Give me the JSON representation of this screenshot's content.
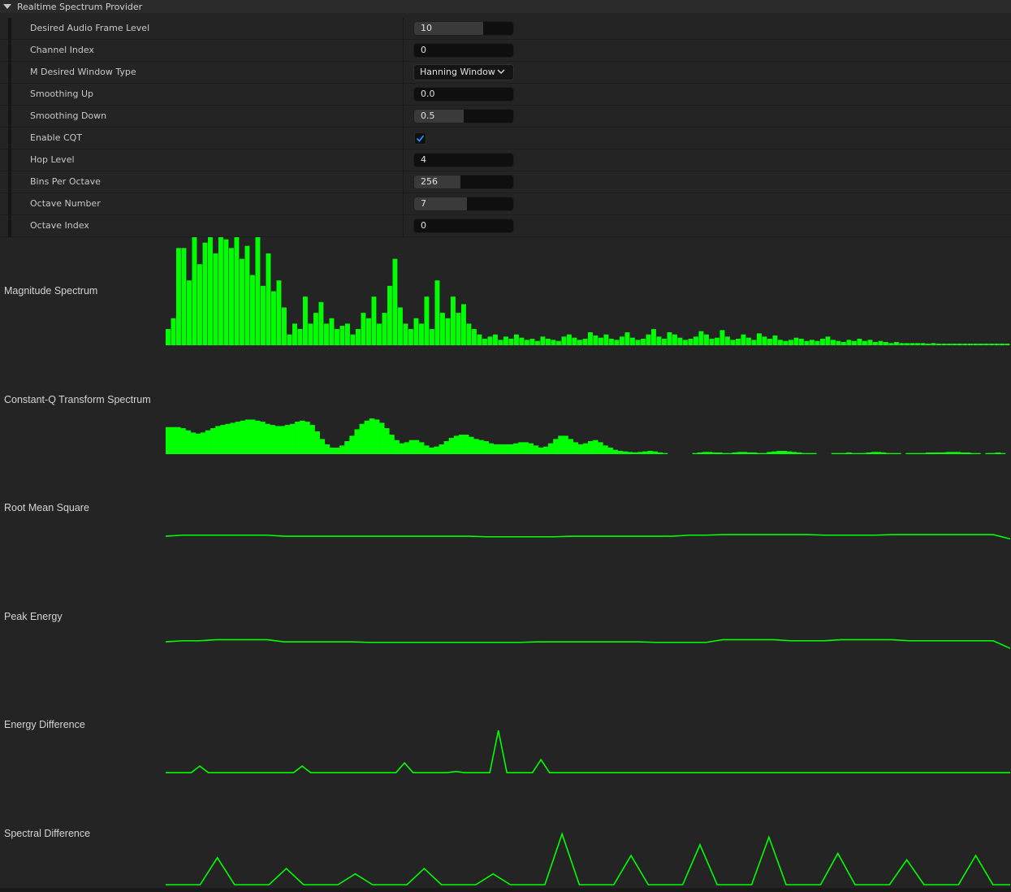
{
  "section": {
    "title": "Realtime Spectrum Provider",
    "icon": "triangle-down-icon"
  },
  "properties": [
    {
      "label": "Desired Audio Frame Level",
      "type": "slider",
      "value": "10",
      "fill": 0.7
    },
    {
      "label": "Channel Index",
      "type": "number",
      "value": "0"
    },
    {
      "label": "M Desired Window Type",
      "type": "dropdown",
      "value": "Hanning Window"
    },
    {
      "label": "Smoothing Up",
      "type": "number",
      "value": "0.0"
    },
    {
      "label": "Smoothing Down",
      "type": "slider",
      "value": "0.5",
      "fill": 0.5
    },
    {
      "label": "Enable CQT",
      "type": "checkbox",
      "checked": true
    },
    {
      "label": "Hop Level",
      "type": "number",
      "value": "4"
    },
    {
      "label": "Bins Per Octave",
      "type": "slider",
      "value": "256",
      "fill": 0.47
    },
    {
      "label": "Octave Number",
      "type": "slider",
      "value": "7",
      "fill": 0.53
    },
    {
      "label": "Octave Index",
      "type": "number",
      "value": "0"
    }
  ],
  "graphs": [
    {
      "label": "Magnitude Spectrum",
      "kind": "spectrum"
    },
    {
      "label": "Constant-Q Transform Spectrum",
      "kind": "cqt"
    },
    {
      "label": "Root Mean Square",
      "kind": "line"
    },
    {
      "label": "Peak Energy",
      "kind": "line"
    },
    {
      "label": "Energy Difference",
      "kind": "line"
    },
    {
      "label": "Spectral Difference",
      "kind": "line"
    }
  ],
  "colors": {
    "accent": "#00ff00",
    "background": "#242424",
    "checkbox": "#1f8fff"
  },
  "chart_data": [
    {
      "type": "bar",
      "title": "Magnitude Spectrum",
      "values": [
        0.15,
        0.25,
        0.9,
        0.9,
        0.6,
        1.0,
        0.75,
        0.95,
        1.0,
        0.85,
        1.0,
        0.98,
        0.9,
        1.0,
        0.8,
        0.92,
        0.65,
        1.0,
        0.55,
        0.85,
        0.5,
        0.6,
        0.35,
        0.1,
        0.2,
        0.15,
        0.45,
        0.2,
        0.3,
        0.4,
        0.2,
        0.25,
        0.15,
        0.18,
        0.2,
        0.1,
        0.15,
        0.3,
        0.25,
        0.45,
        0.2,
        0.3,
        0.55,
        0.8,
        0.35,
        0.2,
        0.15,
        0.25,
        0.2,
        0.45,
        0.15,
        0.6,
        0.3,
        0.25,
        0.45,
        0.3,
        0.38,
        0.2,
        0.15,
        0.1,
        0.06,
        0.08,
        0.1,
        0.05,
        0.08,
        0.06,
        0.1,
        0.07,
        0.05,
        0.06,
        0.04,
        0.08,
        0.06,
        0.05,
        0.04,
        0.08,
        0.1,
        0.07,
        0.05,
        0.06,
        0.12,
        0.09,
        0.07,
        0.1,
        0.06,
        0.05,
        0.08,
        0.12,
        0.07,
        0.05,
        0.06,
        0.1,
        0.15,
        0.08,
        0.06,
        0.12,
        0.1,
        0.07,
        0.05,
        0.06,
        0.08,
        0.13,
        0.1,
        0.06,
        0.07,
        0.14,
        0.08,
        0.05,
        0.06,
        0.1,
        0.07,
        0.05,
        0.11,
        0.08,
        0.06,
        0.09,
        0.05,
        0.04,
        0.05,
        0.07,
        0.06,
        0.04,
        0.05,
        0.04,
        0.06,
        0.08,
        0.05,
        0.04,
        0.03,
        0.05,
        0.04,
        0.06,
        0.04,
        0.05,
        0.03,
        0.04,
        0.03,
        0.02,
        0.03,
        0.02,
        0.02,
        0.02,
        0.02,
        0.02,
        0.015,
        0.02,
        0.015,
        0.015,
        0.015,
        0.015,
        0.015,
        0.015,
        0.015,
        0.015,
        0.015,
        0.015,
        0.015,
        0.015,
        0.015,
        0.015
      ],
      "ylim": [
        0,
        1
      ]
    },
    {
      "type": "area",
      "title": "Constant-Q Transform Spectrum",
      "values": [
        0.25,
        0.25,
        0.25,
        0.24,
        0.22,
        0.2,
        0.19,
        0.2,
        0.22,
        0.24,
        0.26,
        0.27,
        0.28,
        0.29,
        0.3,
        0.31,
        0.32,
        0.32,
        0.31,
        0.3,
        0.28,
        0.27,
        0.26,
        0.26,
        0.27,
        0.28,
        0.3,
        0.31,
        0.3,
        0.27,
        0.21,
        0.14,
        0.09,
        0.06,
        0.06,
        0.08,
        0.12,
        0.17,
        0.23,
        0.28,
        0.31,
        0.33,
        0.32,
        0.29,
        0.24,
        0.18,
        0.13,
        0.1,
        0.11,
        0.13,
        0.13,
        0.11,
        0.08,
        0.06,
        0.07,
        0.09,
        0.12,
        0.15,
        0.17,
        0.18,
        0.18,
        0.16,
        0.14,
        0.13,
        0.12,
        0.1,
        0.09,
        0.09,
        0.09,
        0.09,
        0.1,
        0.11,
        0.11,
        0.1,
        0.08,
        0.06,
        0.07,
        0.1,
        0.14,
        0.17,
        0.17,
        0.14,
        0.11,
        0.09,
        0.1,
        0.12,
        0.13,
        0.11,
        0.08,
        0.06,
        0.04,
        0.03,
        0.025,
        0.02,
        0.015,
        0.02,
        0.025,
        0.03,
        0.025,
        0.015,
        0.01,
        0.0,
        0.0,
        0.0,
        0.0,
        0.0,
        0.01,
        0.015,
        0.02,
        0.02,
        0.015,
        0.015,
        0.01,
        0.01,
        0.015,
        0.02,
        0.02,
        0.015,
        0.015,
        0.01,
        0.01,
        0.02,
        0.025,
        0.03,
        0.03,
        0.025,
        0.02,
        0.015,
        0.01,
        0.01,
        0.01,
        0.0,
        0.0,
        0.0,
        0.01,
        0.01,
        0.01,
        0.015,
        0.01,
        0.01,
        0.01,
        0.015,
        0.02,
        0.02,
        0.015,
        0.01,
        0.01,
        0.01,
        0.0,
        0.01,
        0.01,
        0.01,
        0.01,
        0.015,
        0.015,
        0.015,
        0.015,
        0.02,
        0.02,
        0.02,
        0.015,
        0.015,
        0.01,
        0.01,
        0.0,
        0.01,
        0.01,
        0.015,
        0.01,
        0.0
      ],
      "ylim": [
        0,
        1
      ]
    },
    {
      "type": "line",
      "title": "Root Mean Square",
      "values": [
        0.24,
        0.25,
        0.25,
        0.25,
        0.25,
        0.25,
        0.25,
        0.24,
        0.24,
        0.24,
        0.24,
        0.24,
        0.24,
        0.24,
        0.24,
        0.24,
        0.24,
        0.24,
        0.24,
        0.235,
        0.235,
        0.235,
        0.235,
        0.235,
        0.24,
        0.24,
        0.24,
        0.24,
        0.24,
        0.24,
        0.24,
        0.25,
        0.25,
        0.255,
        0.255,
        0.255,
        0.255,
        0.255,
        0.255,
        0.25,
        0.25,
        0.25,
        0.25,
        0.255,
        0.255,
        0.255,
        0.255,
        0.255,
        0.255,
        0.255,
        0.215
      ],
      "ylim": [
        0,
        1
      ]
    },
    {
      "type": "line",
      "title": "Peak Energy",
      "values": [
        0.27,
        0.28,
        0.28,
        0.29,
        0.29,
        0.29,
        0.29,
        0.27,
        0.27,
        0.27,
        0.27,
        0.27,
        0.265,
        0.265,
        0.265,
        0.265,
        0.265,
        0.265,
        0.265,
        0.265,
        0.265,
        0.265,
        0.27,
        0.27,
        0.27,
        0.27,
        0.27,
        0.27,
        0.27,
        0.265,
        0.265,
        0.265,
        0.265,
        0.29,
        0.29,
        0.29,
        0.29,
        0.28,
        0.28,
        0.28,
        0.29,
        0.29,
        0.29,
        0.29,
        0.28,
        0.28,
        0.28,
        0.28,
        0.28,
        0.28,
        0.21
      ],
      "ylim": [
        0,
        1
      ]
    },
    {
      "type": "line",
      "title": "Energy Difference",
      "values": [
        0.06,
        0.06,
        0.06,
        0.06,
        0.12,
        0.06,
        0.06,
        0.06,
        0.06,
        0.06,
        0.06,
        0.06,
        0.06,
        0.06,
        0.06,
        0.06,
        0.12,
        0.06,
        0.06,
        0.06,
        0.06,
        0.06,
        0.06,
        0.06,
        0.06,
        0.06,
        0.06,
        0.06,
        0.15,
        0.06,
        0.06,
        0.06,
        0.06,
        0.06,
        0.07,
        0.06,
        0.06,
        0.06,
        0.06,
        0.45,
        0.06,
        0.06,
        0.06,
        0.06,
        0.18,
        0.06,
        0.06,
        0.06,
        0.06,
        0.06,
        0.06,
        0.06,
        0.06,
        0.06,
        0.06,
        0.06,
        0.06,
        0.06,
        0.06,
        0.06,
        0.06,
        0.06,
        0.06,
        0.06,
        0.06,
        0.06,
        0.06,
        0.06,
        0.06,
        0.06,
        0.06,
        0.06,
        0.06,
        0.06,
        0.06,
        0.06,
        0.06,
        0.06,
        0.06,
        0.06,
        0.06,
        0.06,
        0.06,
        0.06,
        0.06,
        0.06,
        0.06,
        0.06,
        0.06,
        0.06,
        0.06,
        0.06,
        0.06,
        0.06,
        0.06,
        0.06,
        0.06,
        0.06,
        0.06,
        0.06
      ],
      "ylim": [
        0,
        1
      ]
    },
    {
      "type": "line",
      "title": "Spectral Difference",
      "values": [
        0.03,
        0.03,
        0.03,
        0.28,
        0.03,
        0.03,
        0.03,
        0.18,
        0.03,
        0.03,
        0.03,
        0.13,
        0.03,
        0.03,
        0.03,
        0.18,
        0.03,
        0.03,
        0.03,
        0.13,
        0.03,
        0.03,
        0.03,
        0.5,
        0.03,
        0.03,
        0.03,
        0.3,
        0.03,
        0.03,
        0.03,
        0.4,
        0.03,
        0.03,
        0.03,
        0.47,
        0.03,
        0.03,
        0.03,
        0.32,
        0.03,
        0.03,
        0.03,
        0.26,
        0.03,
        0.03,
        0.03,
        0.3,
        0.03,
        0.03
      ],
      "ylim": [
        0,
        1
      ]
    }
  ]
}
